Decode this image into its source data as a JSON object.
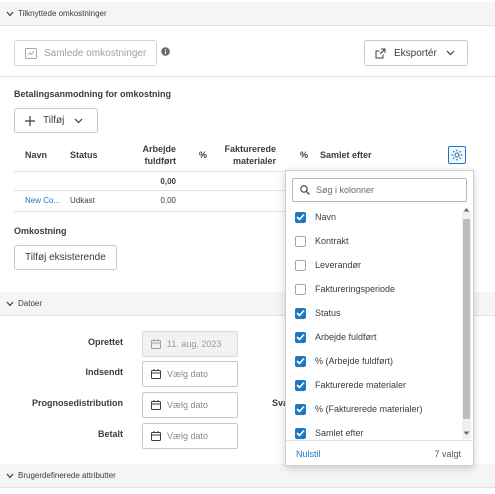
{
  "sections": {
    "related_costs": "Tilknyttede omkostninger",
    "dates": "Datoer",
    "custom_attributes": "Brugerdefinerede attributter"
  },
  "toolbar": {
    "total_costs_label": "Samlede omkostninger",
    "export_label": "Eksportér"
  },
  "payment_request": {
    "title": "Betalingsanmodning for omkostning",
    "add_label": "Tilføj",
    "columns": [
      "Navn",
      "Status",
      "Arbejde\nfuldført",
      "%",
      "Fakturerede\nmaterialer",
      "%",
      "Samlet efter"
    ],
    "total_row": {
      "work_completed": "0,00"
    },
    "rows": [
      {
        "name": "New Co...",
        "status": "Udkast",
        "work_completed": "0,00"
      }
    ]
  },
  "cost": {
    "title": "Omkostning",
    "add_existing_label": "Tilføj eksisterende"
  },
  "dates": {
    "fields": [
      {
        "label": "Oprettet",
        "value": "11. aug. 2023",
        "disabled": true
      },
      {
        "label": "Indsendt",
        "value": "Vælg dato",
        "disabled": false
      },
      {
        "label": "Prognosedistribution",
        "value": "Vælg dato",
        "disabled": false
      },
      {
        "label": "Betalt",
        "value": "Vælg dato",
        "disabled": false
      }
    ],
    "truncated_label": "Sva"
  },
  "column_picker": {
    "search_placeholder": "Søg i kolonner",
    "options": [
      {
        "label": "Navn",
        "checked": true
      },
      {
        "label": "Kontrakt",
        "checked": false
      },
      {
        "label": "Leverandør",
        "checked": false
      },
      {
        "label": "Faktureringsperiode",
        "checked": false
      },
      {
        "label": "Status",
        "checked": true
      },
      {
        "label": "Arbejde fuldført",
        "checked": true
      },
      {
        "label": "% (Arbejde fuldført)",
        "checked": true
      },
      {
        "label": "Fakturerede materialer",
        "checked": true
      },
      {
        "label": "% (Fakturerede materialer)",
        "checked": true
      },
      {
        "label": "Samlet efter",
        "checked": true
      }
    ],
    "reset_label": "Nulstil",
    "selected_count": "7 valgt"
  },
  "colors": {
    "accent": "#1f76c2",
    "header_bg": "#f5f5f5"
  }
}
